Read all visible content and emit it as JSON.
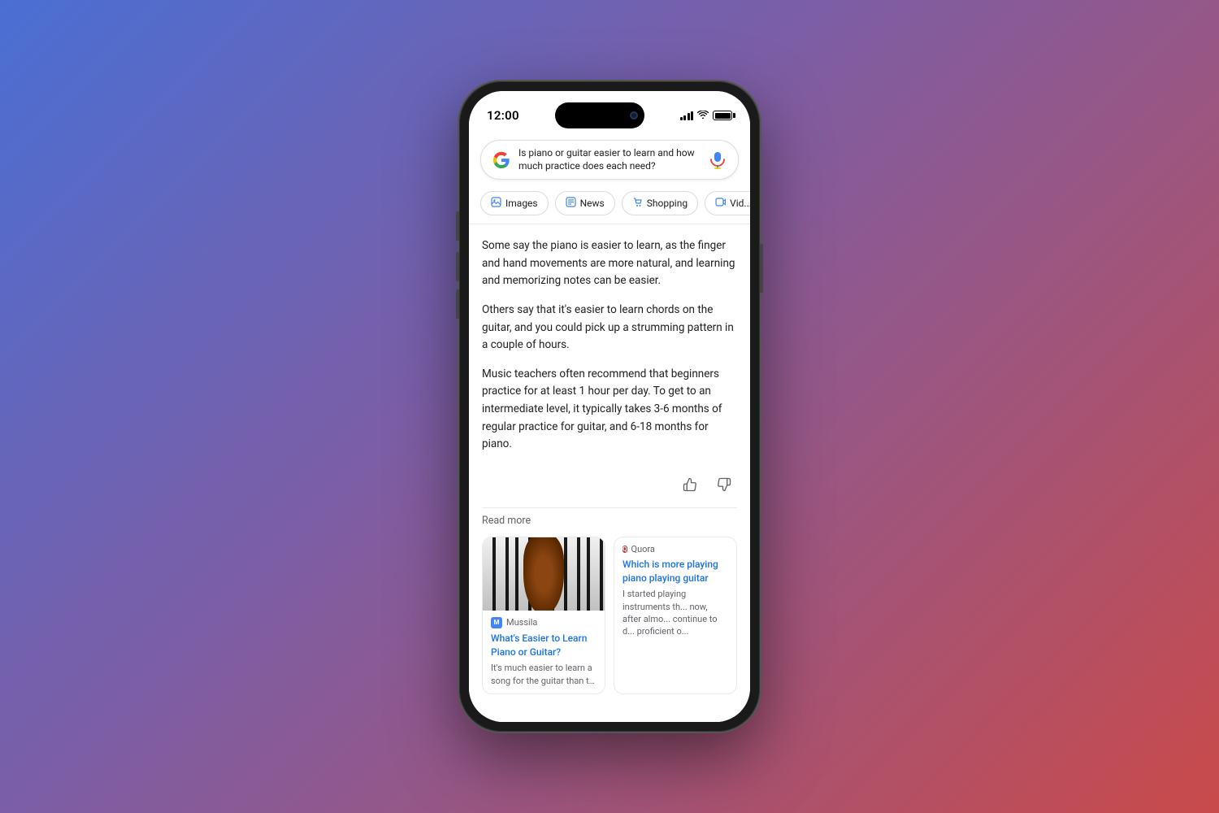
{
  "phone": {
    "status_bar": {
      "time": "12:00",
      "signal_label": "signal bars",
      "wifi_label": "wifi",
      "battery_label": "battery"
    },
    "search": {
      "query": "Is piano or guitar easier to learn and how much practice does each need?",
      "mic_label": "microphone"
    },
    "filter_tabs": [
      {
        "id": "images",
        "label": "Images",
        "icon": "🖼"
      },
      {
        "id": "news",
        "label": "News",
        "icon": "📰"
      },
      {
        "id": "shopping",
        "label": "Shopping",
        "icon": "🛍"
      },
      {
        "id": "videos",
        "label": "Vid...",
        "icon": "▶"
      }
    ],
    "ai_content": {
      "paragraph1": "Some say the piano is easier to learn, as the finger and hand movements are more natural, and learning and memorizing notes can be easier.",
      "paragraph2": "Others say that it's easier to learn chords on the guitar, and you could pick up a strumming pattern in a couple of hours.",
      "paragraph3": "Music teachers often recommend that beginners practice for at least 1 hour per day. To get to an intermediate level, it typically takes 3-6 months of regular practice for guitar, and 6-18 months for piano.",
      "read_more": "Read more",
      "thumbs_up_label": "thumbs up",
      "thumbs_down_label": "thumbs down"
    },
    "source_cards": [
      {
        "id": "mussila",
        "source_name": "Mussila",
        "title": "What's Easier to Learn Piano or Guitar?",
        "snippet": "It's much easier to learn a song for the guitar than to learn it for",
        "has_image": true
      },
      {
        "id": "quora",
        "source_name": "Quora",
        "title": "Which is more playing piano playing guitar",
        "snippet": "I started playing instruments th... now, after almo... continue to d... proficient o..."
      }
    ]
  }
}
